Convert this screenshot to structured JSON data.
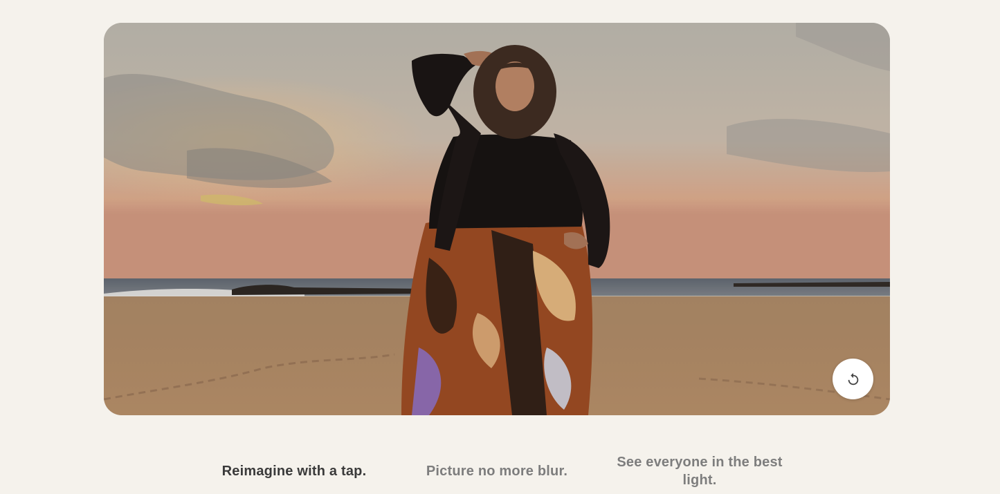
{
  "hero": {
    "image_description_icon": "beach-portrait-image",
    "replay_icon": "replay-icon"
  },
  "tabs": [
    {
      "label": "Reimagine with a tap.",
      "state": "active"
    },
    {
      "label": "Picture no more blur.",
      "state": "inactive"
    },
    {
      "label": "See everyone in the best light.",
      "state": "inactive"
    }
  ],
  "colors": {
    "page_background": "#f5f2ec",
    "active_tab_text": "#3a3a3a",
    "inactive_tab_text": "#7d7d7d",
    "button_background": "#ffffff"
  }
}
